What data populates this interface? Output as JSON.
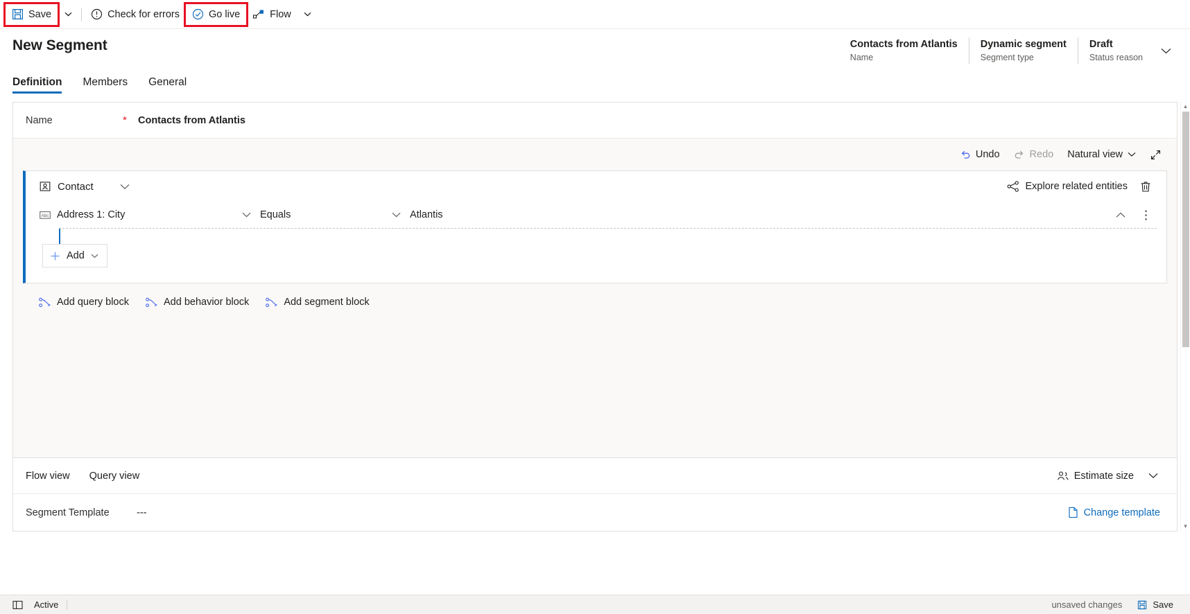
{
  "command_bar": {
    "items": [
      {
        "label": "Save",
        "icon": "save-icon",
        "highlighted": true
      },
      {
        "label": "Check for errors",
        "icon": "error-circle-icon",
        "highlighted": false
      },
      {
        "label": "Go live",
        "icon": "check-circle-icon",
        "highlighted": true
      },
      {
        "label": "Flow",
        "icon": "flow-icon",
        "highlighted": false
      }
    ]
  },
  "header": {
    "title": "New Segment",
    "meta": [
      {
        "value": "Contacts from Atlantis",
        "label": "Name"
      },
      {
        "value": "Dynamic segment",
        "label": "Segment type"
      },
      {
        "value": "Draft",
        "label": "Status reason"
      }
    ],
    "expand_icon": "chevron-down-icon"
  },
  "tabs": [
    {
      "label": "Definition",
      "active": true
    },
    {
      "label": "Members",
      "active": false
    },
    {
      "label": "General",
      "active": false
    }
  ],
  "name_field": {
    "label": "Name",
    "required_marker": "*",
    "value": "Contacts from Atlantis"
  },
  "canvas_toolbar": {
    "undo": {
      "label": "Undo",
      "icon": "undo-icon",
      "disabled": false
    },
    "redo": {
      "label": "Redo",
      "icon": "redo-icon",
      "disabled": true
    },
    "view_mode": {
      "label": "Natural view",
      "icon": "chevron-down-icon"
    },
    "expand": {
      "icon": "expand-diagonal-icon"
    }
  },
  "query_block": {
    "entity": {
      "label": "Contact",
      "icon": "contact-icon"
    },
    "collapse_icon": "chevron-down-icon",
    "explore": {
      "label": "Explore related entities",
      "icon": "share-nodes-icon"
    },
    "delete": {
      "icon": "trash-icon"
    },
    "condition": {
      "attribute": "Address 1: City",
      "attribute_icon": "abc-text-icon",
      "operator": "Equals",
      "value": "Atlantis",
      "collapse_icon": "chevron-up-icon",
      "more_icon": "more-vertical-icon"
    },
    "add_button": {
      "label": "Add",
      "icon": "plus-icon",
      "caret": "chevron-down-icon"
    }
  },
  "block_links": [
    {
      "label": "Add query block",
      "icon": "query-block-icon"
    },
    {
      "label": "Add behavior block",
      "icon": "behavior-block-icon"
    },
    {
      "label": "Add segment block",
      "icon": "segment-block-icon"
    }
  ],
  "view_bar": {
    "tabs": [
      {
        "label": "Flow view"
      },
      {
        "label": "Query view"
      }
    ],
    "estimate": {
      "label": "Estimate size",
      "icon": "people-icon"
    },
    "collapse_icon": "chevron-down-icon"
  },
  "template_row": {
    "label": "Segment Template",
    "value": "---",
    "change": {
      "label": "Change template",
      "icon": "document-icon"
    }
  },
  "status_bar": {
    "left_icon": "layout-icon",
    "state": "Active",
    "unsaved": "unsaved changes",
    "save": {
      "label": "Save",
      "icon": "save-icon"
    }
  },
  "colors": {
    "accent": "#0f6cbd",
    "highlight": "#e81123",
    "required": "#e81123",
    "canvas_bg": "#faf9f8"
  }
}
